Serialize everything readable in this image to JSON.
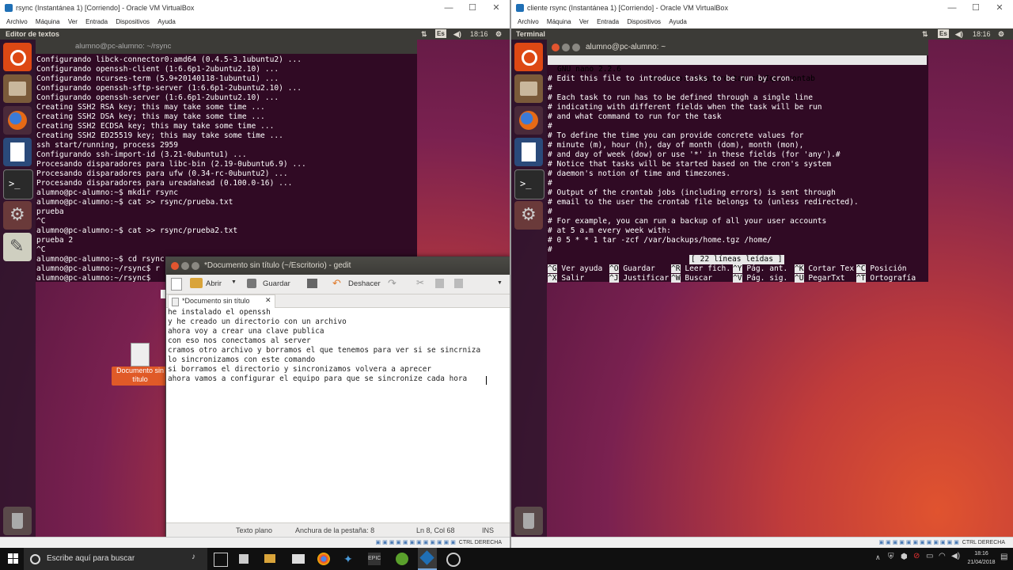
{
  "left_vm": {
    "title": "rsync (Instantánea 1) [Corriendo] - Oracle VM VirtualBox",
    "menu": [
      "Archivo",
      "Máquina",
      "Ver",
      "Entrada",
      "Dispositivos",
      "Ayuda"
    ],
    "topbar_app": "Editor de textos",
    "clock": "18:16",
    "kb": "Es",
    "terminal_title": "alumno@pc-alumno: ~/rsync",
    "terminal_lines": [
      "Configurando libck-connector0:amd64 (0.4.5-3.1ubuntu2) ...",
      "Configurando openssh-client (1:6.6p1-2ubuntu2.10) ...",
      "Configurando ncurses-term (5.9+20140118-1ubuntu1) ...",
      "Configurando openssh-sftp-server (1:6.6p1-2ubuntu2.10) ...",
      "Configurando openssh-server (1:6.6p1-2ubuntu2.10) ...",
      "Creating SSH2 RSA key; this may take some time ...",
      "Creating SSH2 DSA key; this may take some time ...",
      "Creating SSH2 ECDSA key; this may take some time ...",
      "Creating SSH2 ED25519 key; this may take some time ...",
      "ssh start/running, process 2959",
      "Configurando ssh-import-id (3.21-0ubuntu1) ...",
      "Procesando disparadores para libc-bin (2.19-0ubuntu6.9) ...",
      "Procesando disparadores para ufw (0.34-rc-0ubuntu2) ...",
      "Procesando disparadores para ureadahead (0.100.0-16) ...",
      "alumno@pc-alumno:~$ mkdir rsync",
      "alumno@pc-alumno:~$ cat >> rsync/prueba.txt",
      "prueba",
      "^C",
      "alumno@pc-alumno:~$ cat >> rsync/prueba2.txt",
      "prueba 2",
      "^C",
      "alumno@pc-alumno:~$ cd rsync",
      "alumno@pc-alumno:~/rsync$ r",
      "alumno@pc-alumno:~/rsync$ "
    ],
    "desktop_icon_label": "Documento sin título",
    "status_right": "CTRL DERECHA"
  },
  "gedit": {
    "title": "*Documento sin título (~/Escritorio) - gedit",
    "toolbar": {
      "open": "Abrir",
      "save": "Guardar",
      "undo": "Deshacer"
    },
    "tab": "*Documento sin título",
    "lines": [
      "he instalado el openssh",
      "y he creado un directorio con un archivo",
      "ahora voy a crear una clave publica",
      "con eso nos conectamos al server",
      "cramos otro archivo y borramos el que tenemos para ver si se sincrniza",
      "lo sincronizamos con este comando",
      "si borramos el directorio y sincronizamos volvera a aprecer",
      "ahora vamos a configurar el equipo para que se sincronize cada hora"
    ],
    "status": {
      "mode": "Texto plano",
      "tab_width": "Anchura de la pestaña: 8",
      "position": "Ln 8, Col 68",
      "ins": "INS"
    }
  },
  "right_vm": {
    "title": "cliente rsync (Instantánea 1) [Corriendo] - Oracle VM VirtualBox",
    "menu": [
      "Archivo",
      "Máquina",
      "Ver",
      "Entrada",
      "Dispositivos",
      "Ayuda"
    ],
    "topbar_app": "Terminal",
    "clock": "18:16",
    "kb": "Es",
    "terminal_title": "alumno@pc-alumno: ~",
    "nano_version": "GNU nano 2.2.6",
    "nano_file": "Archivo: /tmp/crontab.c6gIqL/crontab",
    "nano_lines": [
      "# Edit this file to introduce tasks to be run by cron.",
      "#",
      "# Each task to run has to be defined through a single line",
      "# indicating with different fields when the task will be run",
      "# and what command to run for the task",
      "#",
      "# To define the time you can provide concrete values for",
      "# minute (m), hour (h), day of month (dom), month (mon),",
      "# and day of week (dow) or use '*' in these fields (for 'any').#",
      "# Notice that tasks will be started based on the cron's system",
      "# daemon's notion of time and timezones.",
      "#",
      "# Output of the crontab jobs (including errors) is sent through",
      "# email to the user the crontab file belongs to (unless redirected).",
      "#",
      "# For example, you can run a backup of all your user accounts",
      "# at 5 a.m every week with:",
      "# 0 5 * * 1 tar -zcf /var/backups/home.tgz /home/",
      "#"
    ],
    "nano_status": "[ 22 líneas leídas ]",
    "shortcuts_row1": [
      {
        "k": "^G",
        "t": "Ver ayuda"
      },
      {
        "k": "^O",
        "t": "Guardar"
      },
      {
        "k": "^R",
        "t": "Leer fich."
      },
      {
        "k": "^Y",
        "t": "Pág. ant."
      },
      {
        "k": "^K",
        "t": "Cortar Tex"
      },
      {
        "k": "^C",
        "t": "Posición"
      }
    ],
    "shortcuts_row2": [
      {
        "k": "^X",
        "t": "Salir"
      },
      {
        "k": "^J",
        "t": "Justificar"
      },
      {
        "k": "^W",
        "t": "Buscar"
      },
      {
        "k": "^V",
        "t": "Pág. sig."
      },
      {
        "k": "^U",
        "t": "PegarTxt"
      },
      {
        "k": "^T",
        "t": "Ortografía"
      }
    ],
    "status_right": "CTRL DERECHA"
  },
  "taskbar": {
    "search_placeholder": "Escribe aquí para buscar",
    "time": "18:16",
    "date": "21/04/2018"
  },
  "colors": {
    "ubuntu_orange": "#dd4814",
    "terminal_bg": "#300a24",
    "nano_bar": "#e8e8e8"
  }
}
